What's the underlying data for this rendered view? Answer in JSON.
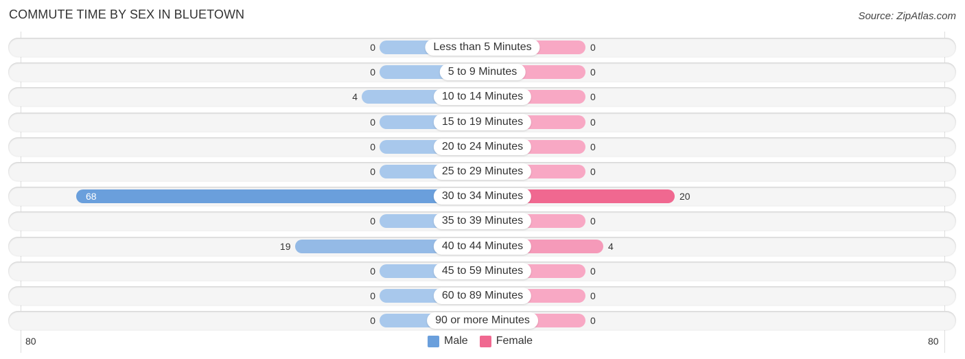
{
  "title": "COMMUTE TIME BY SEX IN BLUETOWN",
  "source": "Source: ZipAtlas.com",
  "colors": {
    "male": "#6a9fdc",
    "female": "#f06890",
    "male_light": "#a8c8ec",
    "female_light": "#f8a8c4"
  },
  "chart_data": {
    "type": "bar",
    "orientation": "horizontal-diverging",
    "title": "COMMUTE TIME BY SEX IN BLUETOWN",
    "categories": [
      "Less than 5 Minutes",
      "5 to 9 Minutes",
      "10 to 14 Minutes",
      "15 to 19 Minutes",
      "20 to 24 Minutes",
      "25 to 29 Minutes",
      "30 to 34 Minutes",
      "35 to 39 Minutes",
      "40 to 44 Minutes",
      "45 to 59 Minutes",
      "60 to 89 Minutes",
      "90 or more Minutes"
    ],
    "series": [
      {
        "name": "Male",
        "side": "left",
        "values": [
          0,
          0,
          4,
          0,
          0,
          0,
          68,
          0,
          19,
          0,
          0,
          0
        ]
      },
      {
        "name": "Female",
        "side": "right",
        "values": [
          0,
          0,
          0,
          0,
          0,
          0,
          20,
          0,
          4,
          0,
          0,
          0
        ]
      }
    ],
    "axis": {
      "left_max_label": "80",
      "right_max_label": "80",
      "range": [
        80,
        80
      ]
    },
    "legend": [
      "Male",
      "Female"
    ],
    "legend_position": "bottom-center",
    "xlabel": "",
    "ylabel": ""
  }
}
